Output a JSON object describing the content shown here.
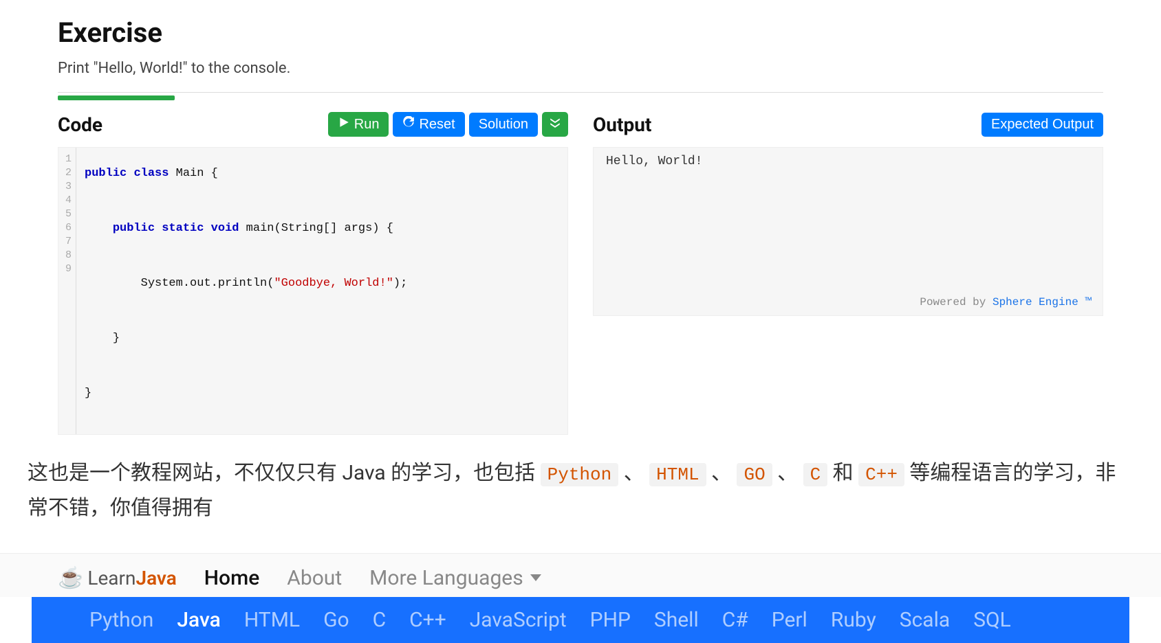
{
  "exercise": {
    "heading": "Exercise",
    "description": "Print \"Hello, World!\" to the console."
  },
  "code_panel": {
    "title": "Code",
    "run_label": "Run",
    "reset_label": "Reset",
    "solution_label": "Solution",
    "line_numbers": [
      "1",
      "2",
      "3",
      "4",
      "5",
      "6",
      "7",
      "8",
      "9"
    ],
    "code_tokens": {
      "l1": {
        "kw1": "public",
        "kw2": "class",
        "rest": " Main {"
      },
      "l3": {
        "kw1": "public",
        "kw2": "static",
        "kw3": "void",
        "rest": " main(String[] args) {"
      },
      "l5": {
        "pre": "        System.out.println(",
        "str": "\"Goodbye, World!\"",
        "post": ");"
      },
      "l7": "    }",
      "l9": "}"
    }
  },
  "output_panel": {
    "title": "Output",
    "expected_button": "Expected Output",
    "output_text": "Hello, World!",
    "powered_prefix": "Powered by ",
    "powered_link": "Sphere Engine ™"
  },
  "article": {
    "text_parts": {
      "p0": "这也是一个教程网站，不仅仅只有 Java 的学习，也包括 ",
      "sep1": " 、 ",
      "sep2": " 、 ",
      "sep3": " 、 ",
      "sep4": " 和 ",
      "p5": " 等编程语言的学习，非常不错，你值得拥有"
    },
    "chips": [
      "Python",
      "HTML",
      "GO",
      "C",
      "C++"
    ]
  },
  "nav": {
    "logo_learn": "Learn",
    "logo_java": "Java",
    "items": [
      {
        "label": "Home",
        "active": true
      },
      {
        "label": "About",
        "active": false
      },
      {
        "label": "More Languages",
        "active": false,
        "dropdown": true
      }
    ]
  },
  "lang_bar": {
    "items": [
      {
        "label": "Python",
        "active": false
      },
      {
        "label": "Java",
        "active": true
      },
      {
        "label": "HTML",
        "active": false
      },
      {
        "label": "Go",
        "active": false
      },
      {
        "label": "C",
        "active": false
      },
      {
        "label": "C++",
        "active": false
      },
      {
        "label": "JavaScript",
        "active": false
      },
      {
        "label": "PHP",
        "active": false
      },
      {
        "label": "Shell",
        "active": false
      },
      {
        "label": "C#",
        "active": false
      },
      {
        "label": "Perl",
        "active": false
      },
      {
        "label": "Ruby",
        "active": false
      },
      {
        "label": "Scala",
        "active": false
      },
      {
        "label": "SQL",
        "active": false
      }
    ]
  }
}
